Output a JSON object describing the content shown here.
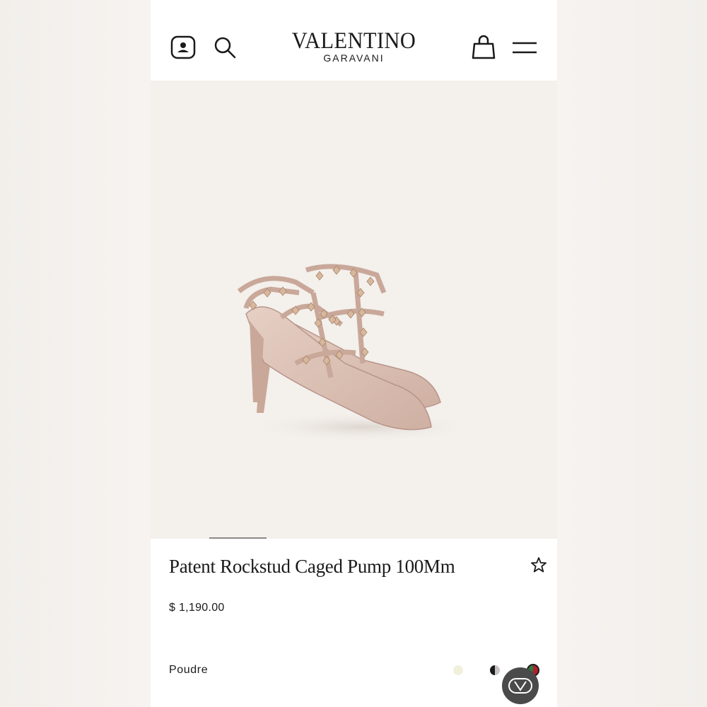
{
  "header": {
    "logo_main": "VALENTINO",
    "logo_sub": "GARAVANI",
    "icons": [
      "account-icon",
      "search-icon",
      "shopping-bag-icon",
      "menu-icon"
    ]
  },
  "gallery": {
    "image_alt": "Patent Rockstud Caged Pump 100Mm product image",
    "active_index": 1
  },
  "product": {
    "title": "Patent Rockstud Caged Pump 100Mm",
    "price": "$ 1,190.00",
    "color_name": "Poudre",
    "swatches": [
      {
        "name": "ivory",
        "color": "#f1f0dd"
      },
      {
        "name": "black-rose",
        "color": "#1b1b1b"
      },
      {
        "name": "green-red",
        "color": "#b21f2d",
        "selected": true
      }
    ]
  },
  "colors": {
    "background": "#f3f0ec",
    "text": "#1a1a1a",
    "badge": "#4a4a4a"
  }
}
